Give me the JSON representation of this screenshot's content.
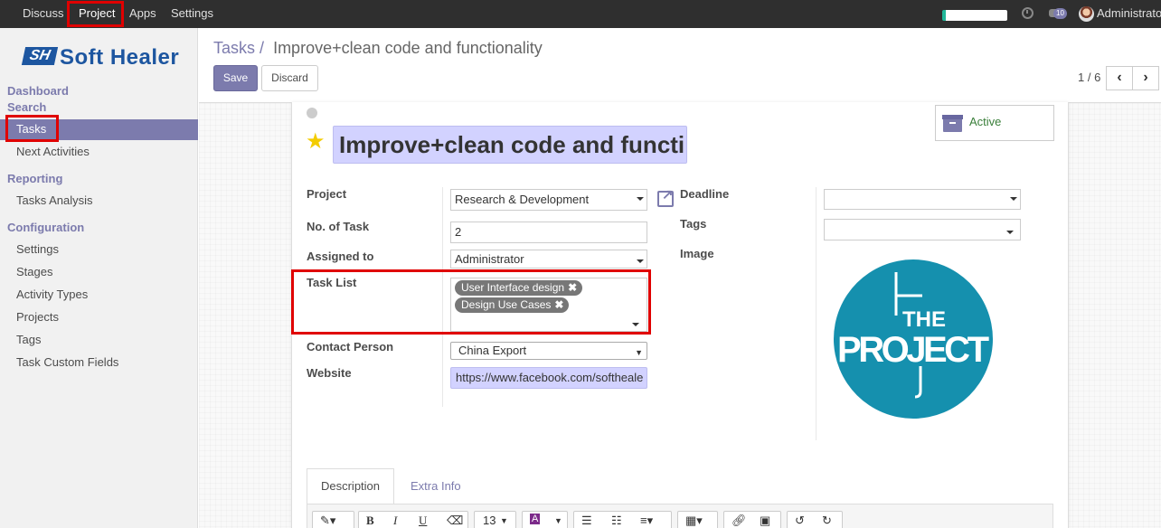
{
  "topnav": {
    "items": [
      "Discuss",
      "Project",
      "Apps",
      "Settings"
    ],
    "notification_count": "10",
    "user": "Administrator"
  },
  "sidebar": {
    "logo_mark": "SH",
    "logo_text": "Soft Healer",
    "sections": [
      {
        "label": "Dashboard",
        "items": []
      },
      {
        "label": "Search",
        "items": [
          "Tasks",
          "Next Activities"
        ]
      },
      {
        "label": "Reporting",
        "items": [
          "Tasks Analysis"
        ]
      },
      {
        "label": "Configuration",
        "items": [
          "Settings",
          "Stages",
          "Activity Types",
          "Projects",
          "Tags",
          "Task Custom Fields"
        ]
      }
    ]
  },
  "breadcrumb": {
    "parent": "Tasks",
    "separator": "/",
    "current": "Improve+clean code and functionality"
  },
  "buttons": {
    "save": "Save",
    "discard": "Discard"
  },
  "pager": {
    "value": "1 / 6",
    "prev": "‹",
    "next": "›"
  },
  "record": {
    "title": "Improve+clean code and functi",
    "active_label": "Active"
  },
  "fields": {
    "project": {
      "label": "Project",
      "value": "Research & Development"
    },
    "no_of_task": {
      "label": "No. of Task",
      "value": "2"
    },
    "assigned_to": {
      "label": "Assigned to",
      "value": "Administrator"
    },
    "task_list": {
      "label": "Task List",
      "tags": [
        "User Interface design",
        "Design Use Cases"
      ]
    },
    "contact_person": {
      "label": "Contact Person",
      "value": "China Export"
    },
    "website": {
      "label": "Website",
      "value": "https://www.facebook.com/softheale"
    },
    "deadline": {
      "label": "Deadline",
      "value": ""
    },
    "tags": {
      "label": "Tags",
      "value": ""
    },
    "image": {
      "label": "Image",
      "logo_text_top": "THE",
      "logo_text_main": "PROJECT"
    }
  },
  "tabs": [
    "Description",
    "Extra Info"
  ],
  "editor_toolbar": {
    "font_size": "13"
  },
  "colors": {
    "accent": "#7c7bad",
    "highlight_red": "#e00000",
    "logo_teal": "#1590ae"
  }
}
